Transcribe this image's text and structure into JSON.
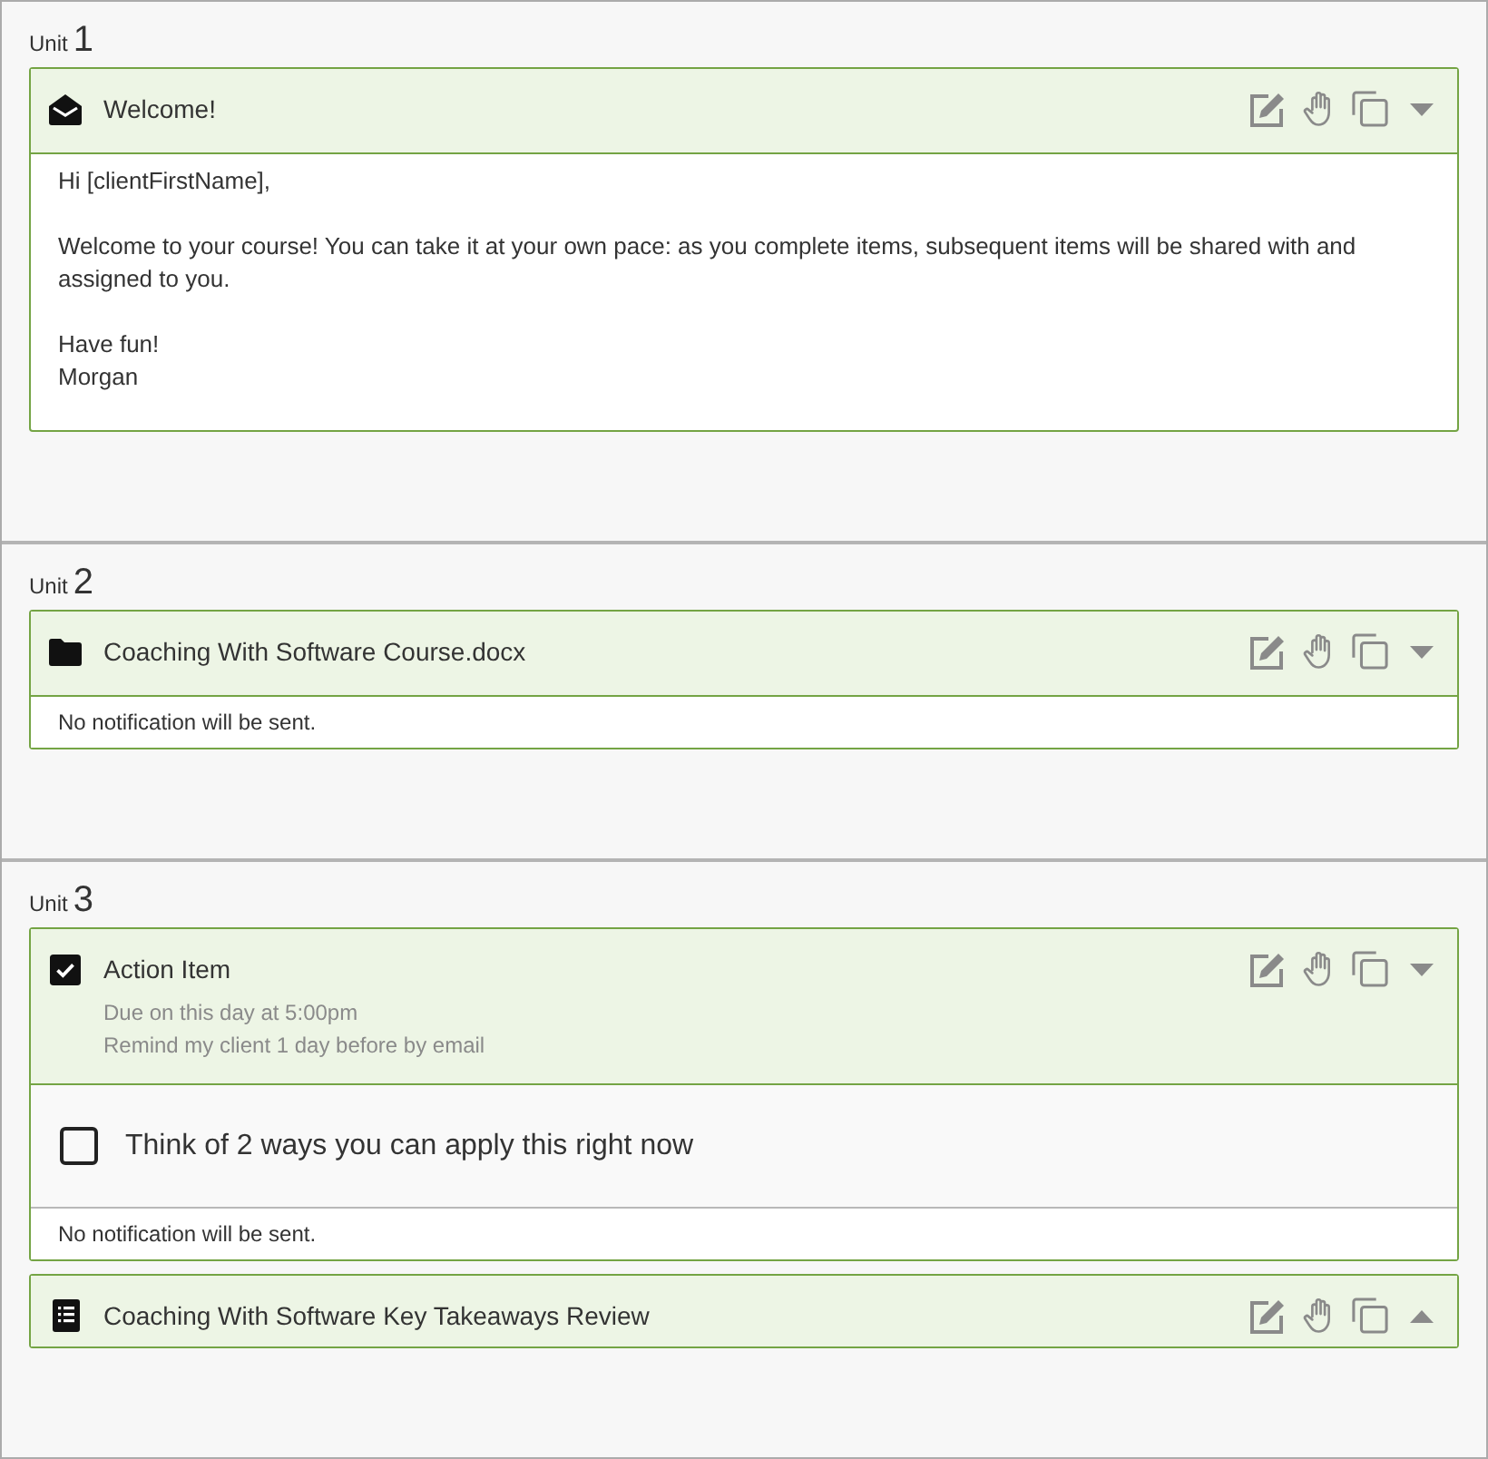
{
  "units": [
    {
      "label": "Unit",
      "number": "1",
      "items": [
        {
          "kind": "message",
          "title": "Welcome!",
          "expanded": true,
          "paragraphs": [
            [
              "Hi [clientFirstName],"
            ],
            [
              "Welcome to your course! You can take it at your own pace: as you complete items, subsequent items will be shared with and assigned to you."
            ],
            [
              "Have fun!",
              "Morgan"
            ]
          ]
        }
      ]
    },
    {
      "label": "Unit",
      "number": "2",
      "items": [
        {
          "kind": "file",
          "title": "Coaching With Software Course.docx",
          "expanded": true,
          "notice": "No notification will be sent."
        }
      ]
    },
    {
      "label": "Unit",
      "number": "3",
      "items": [
        {
          "kind": "action",
          "title": "Action Item",
          "expanded": true,
          "schedule": [
            "Due on this day at 5:00pm",
            "Remind my client 1 day before by email"
          ],
          "tasks": [
            {
              "label": "Think of 2 ways you can apply this right now",
              "checked": false
            }
          ],
          "notice": "No notification will be sent."
        },
        {
          "kind": "form",
          "title": "Coaching With Software Key Takeaways Review",
          "expanded": false
        }
      ]
    }
  ]
}
